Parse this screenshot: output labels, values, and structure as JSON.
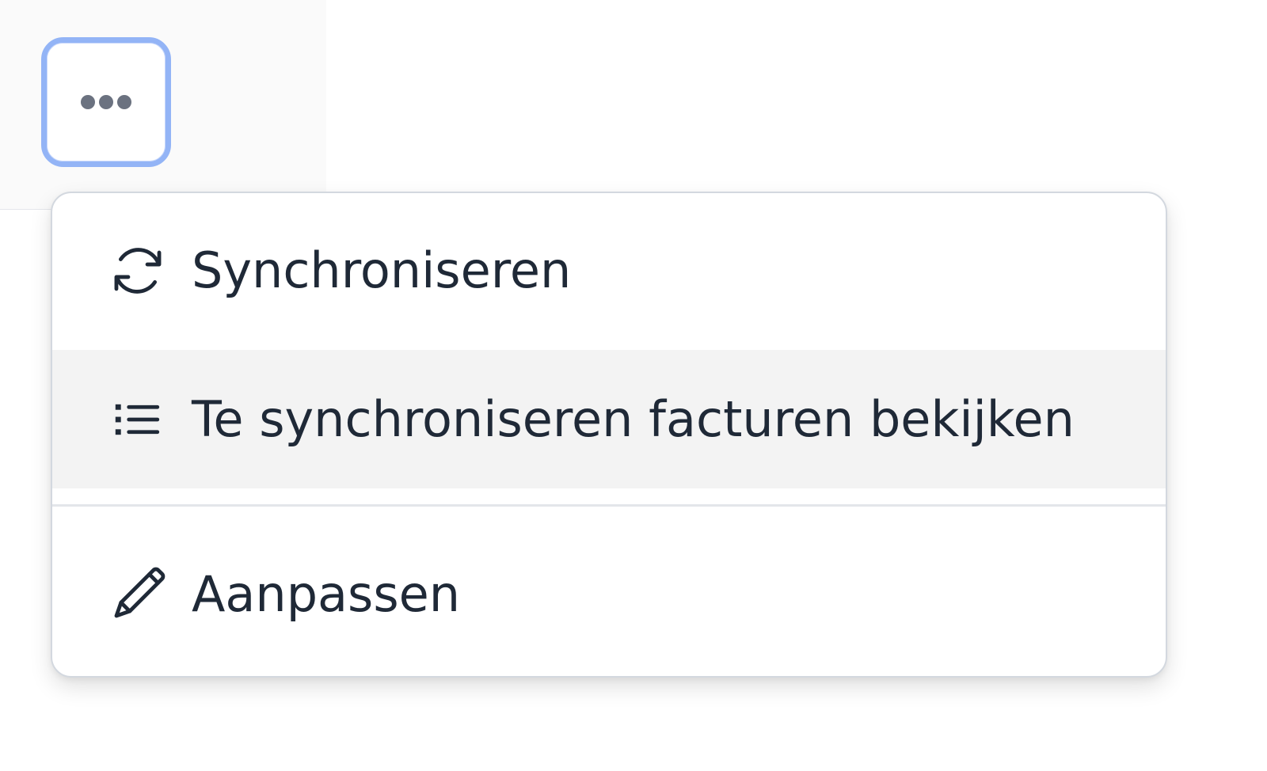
{
  "toolbar": {
    "more_button_icon": "ellipsis-horizontal-icon",
    "focus_ring_color": "#93b4f6"
  },
  "menu": {
    "items": [
      {
        "label": "Synchroniseren",
        "icon": "refresh-icon"
      },
      {
        "label": "Te synchroniseren facturen bekijken",
        "icon": "list-bullet-icon",
        "highlighted": true
      },
      {
        "label": "Aanpassen",
        "icon": "pencil-icon"
      }
    ]
  }
}
